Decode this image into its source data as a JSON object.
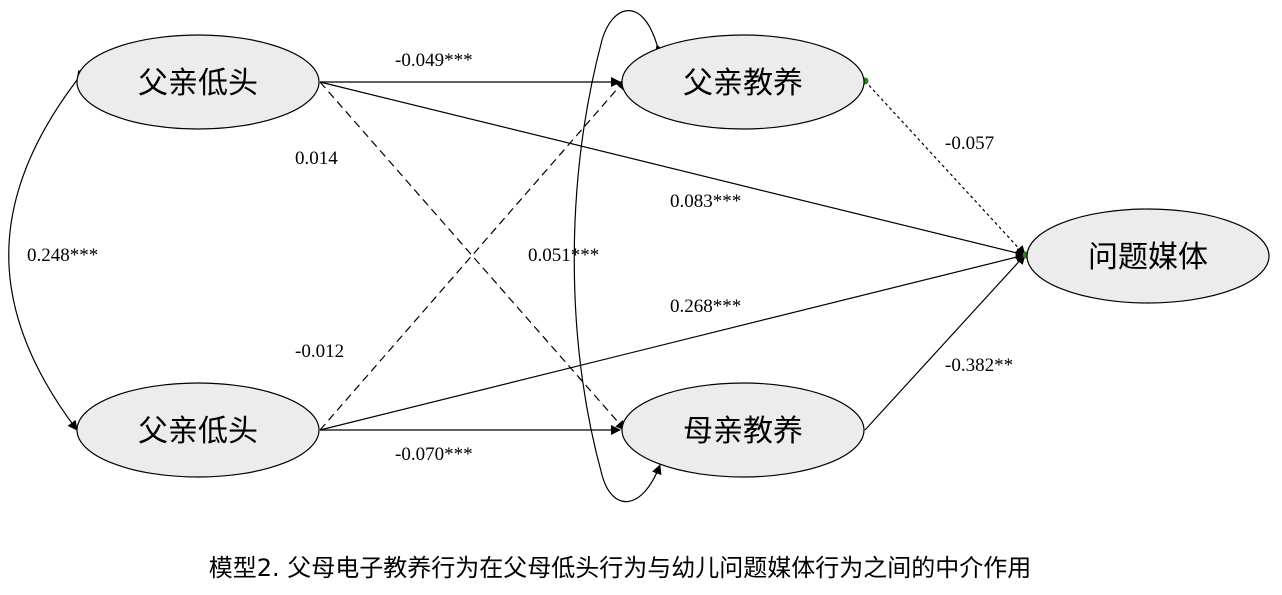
{
  "nodes": {
    "father_phubbing": "父亲低头",
    "mother_phubbing": "父亲低头",
    "father_mediation": "父亲教养",
    "mother_mediation": "母亲教养",
    "child_media": "问题媒体"
  },
  "coefficients": {
    "fp_to_fm": "-0.049***",
    "fp_to_mm": "0.014",
    "fp_to_child": "0.083***",
    "mp_to_mm": "-0.070***",
    "mp_to_fm": "-0.012",
    "mp_to_child": "0.268***",
    "fm_to_child": "-0.057",
    "mm_to_child": "-0.382**",
    "phubbing_cov": "0.248***",
    "mediation_cov": "0.051***"
  },
  "caption": "模型2. 父母电子教养行为在父母低头行为与幼儿问题媒体行为之间的中介作用"
}
